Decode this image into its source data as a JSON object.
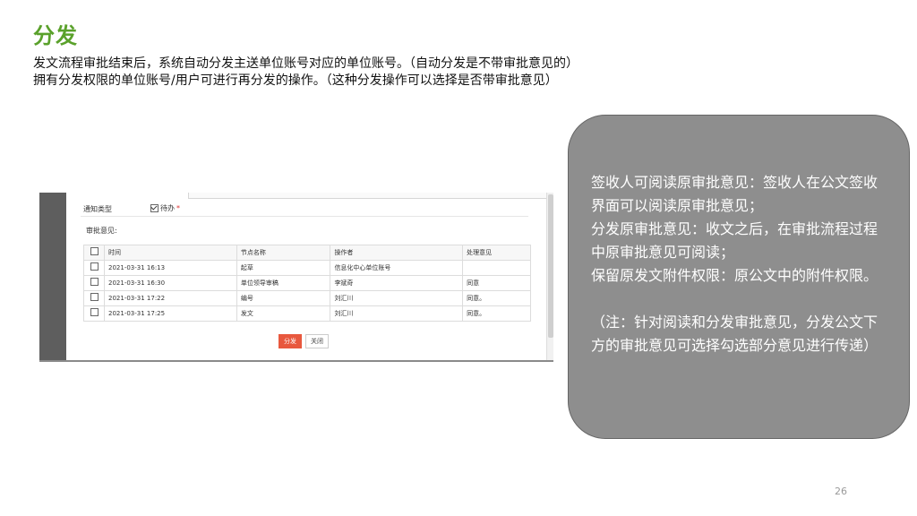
{
  "slide": {
    "title": "分发",
    "intro_lines": [
      "发文流程审批结束后，系统自动分发主送单位账号对应的单位账号。（自动分发是不带审批意见的）",
      "拥有分发权限的单位账号/用户可进行再分发的操作。（这种分发操作可以选择是否带审批意见）"
    ],
    "page_number": "26"
  },
  "screenshot": {
    "notice_type_label": "通知类型",
    "notice_option": "待办",
    "required_mark": "*",
    "opinions_label": "审批意见:",
    "columns": [
      "时间",
      "节点名称",
      "操作者",
      "处理意见"
    ],
    "rows": [
      {
        "time": "2021-03-31 16:13",
        "node": "起草",
        "operator": "信息化中心单位账号",
        "opinion": ""
      },
      {
        "time": "2021-03-31 16:30",
        "node": "单位领导审稿",
        "operator": "李斌奇",
        "opinion": "同意"
      },
      {
        "time": "2021-03-31 17:22",
        "node": "编号",
        "operator": "刘汇川",
        "opinion": "同意。"
      },
      {
        "time": "2021-03-31 17:25",
        "node": "发文",
        "operator": "刘汇川",
        "opinion": "同意。"
      }
    ],
    "distribute_button": "分发",
    "close_button": "关闭"
  },
  "callout": {
    "lines": [
      "签收人可阅读原审批意见：签收人在公文签收界面可以阅读原审批意见；",
      "分发原审批意见：收文之后，在审批流程过程中原审批意见可阅读；",
      "保留原发文附件权限：原公文中的附件权限。"
    ],
    "note": "（注：针对阅读和分发审批意见，分发公文下方的审批意见可选择勾选部分意见进行传递）"
  },
  "colors": {
    "title_green": "#5aa12b",
    "callout_fill": "#8e8e8e",
    "primary_button": "#e8583e"
  }
}
